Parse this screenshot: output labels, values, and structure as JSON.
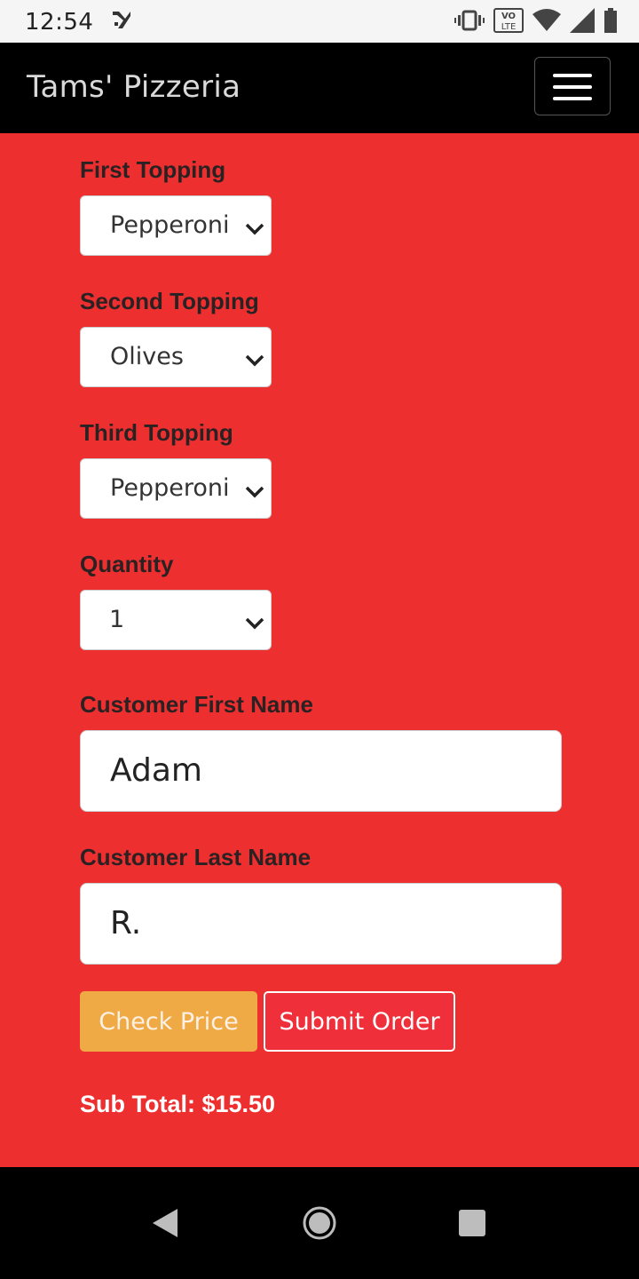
{
  "status_bar": {
    "time": "12:54",
    "icons": [
      "notification-icon",
      "vibrate-icon",
      "volte-icon",
      "wifi-icon",
      "signal-icon",
      "battery-icon"
    ],
    "volte_text": "VO LTE"
  },
  "navbar": {
    "brand": "Tams' Pizzeria",
    "menu_icon": "hamburger-menu-icon"
  },
  "form": {
    "first_topping": {
      "label": "First Topping",
      "value": "Pepperoni"
    },
    "second_topping": {
      "label": "Second Topping",
      "value": "Olives"
    },
    "third_topping": {
      "label": "Third Topping",
      "value": "Pepperoni"
    },
    "quantity": {
      "label": "Quantity",
      "value": "1"
    },
    "first_name": {
      "label": "Customer First Name",
      "value": "Adam"
    },
    "last_name": {
      "label": "Customer Last Name",
      "value": "R."
    },
    "check_price_label": "Check Price",
    "submit_order_label": "Submit Order",
    "subtotal": "Sub Total: $15.50"
  },
  "nav_bar": {
    "icons": [
      "back-icon",
      "home-icon",
      "recents-icon"
    ]
  },
  "colors": {
    "background": "#ee2f30",
    "navbar": "#000000",
    "check_price_button": "#efaa46",
    "submit_button": "#ef2f3a"
  }
}
